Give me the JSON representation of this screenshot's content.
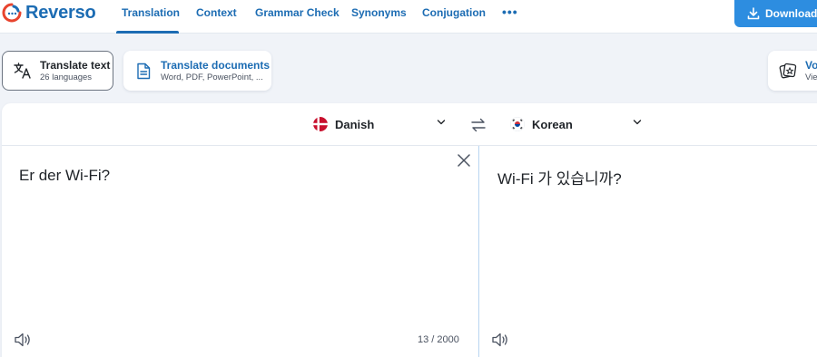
{
  "brand": {
    "name": "Reverso"
  },
  "nav": {
    "items": [
      {
        "label": "Translation",
        "active": true
      },
      {
        "label": "Context",
        "active": false
      },
      {
        "label": "Grammar Check",
        "active": false
      },
      {
        "label": "Synonyms",
        "active": false
      },
      {
        "label": "Conjugation",
        "active": false
      }
    ],
    "more_label": "•••",
    "download_label": "Download f"
  },
  "modes": {
    "text": {
      "title": "Translate text",
      "subtitle": "26 languages",
      "icon": "translate-icon"
    },
    "documents": {
      "title": "Translate documents",
      "subtitle": "Word, PDF, PowerPoint, ...",
      "icon": "document-icon"
    },
    "vocabulary": {
      "title": "Voc",
      "subtitle": "View",
      "icon": "flashcards-icon"
    }
  },
  "translator": {
    "source_language": "Danish",
    "target_language": "Korean",
    "source_text": "Er der Wi-Fi?",
    "target_text": "Wi-Fi 가 있습니까?",
    "char_count": "13 / 2000"
  },
  "colors": {
    "brand_blue": "#1c6cb3",
    "download_button": "#2d8de0",
    "background": "#f0f3f8",
    "divider": "#b9d5f1"
  }
}
